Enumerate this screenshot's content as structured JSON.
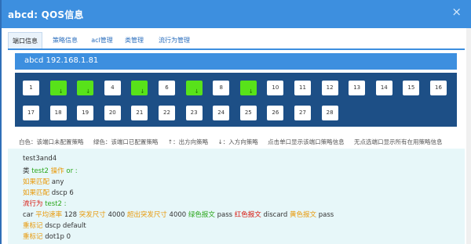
{
  "window": {
    "title": "abcd: QOS信息",
    "close_icon": "×"
  },
  "tabs": [
    {
      "label": "端口信息",
      "active": true
    },
    {
      "label": "策略信息"
    },
    {
      "label": "acl管理"
    },
    {
      "label": "类管理"
    },
    {
      "label": "流行为管理"
    }
  ],
  "device": {
    "header": "abcd 192.168.1.81"
  },
  "ports": {
    "row1": [
      "1",
      "2",
      "3",
      "4",
      "5",
      "6",
      "7",
      "8",
      "9",
      "10",
      "11",
      "12",
      "13",
      "14",
      "15",
      "16"
    ],
    "row2": [
      "17",
      "18",
      "19",
      "20",
      "21",
      "22",
      "23",
      "24",
      "25",
      "26",
      "27",
      "28"
    ],
    "configured": [
      "2",
      "3",
      "5",
      "7",
      "9"
    ],
    "arrow_glyph": "↓"
  },
  "legend": [
    "白色：该端口未配置策略",
    "绿色：该端口已配置策略",
    "↑：出方向策略",
    "↓：入方向策略",
    "点击单口显示该端口策略信息",
    "无点选端口显示所有在用策略信息"
  ],
  "policy": {
    "name": "test3and4",
    "class_prefix": "类",
    "class_name": "test2",
    "class_op": "操作",
    "class_op_value": "or :",
    "match1_label": "如果匹配",
    "match1_value": "any",
    "match2_label": "如果匹配",
    "match2_value": "dscp 6",
    "behavior_label": "流行为",
    "behavior_name": "test2 :",
    "car_prefix": "car",
    "car_rate_label": "平均速率",
    "car_rate": "128",
    "car_burst_label": "突发尺寸",
    "car_burst": "4000",
    "car_excess_label": "超出突发尺寸",
    "car_excess": "4000",
    "green_label": "绿色报文",
    "green_action": "pass",
    "red_label": "红色报文",
    "red_action": "discard",
    "yellow_label": "黄色报文",
    "yellow_action": "pass",
    "remark1_label": "重标记",
    "remark1_value": "dscp default",
    "remark2_label": "重标记",
    "remark2_value": "dot1p 0"
  }
}
